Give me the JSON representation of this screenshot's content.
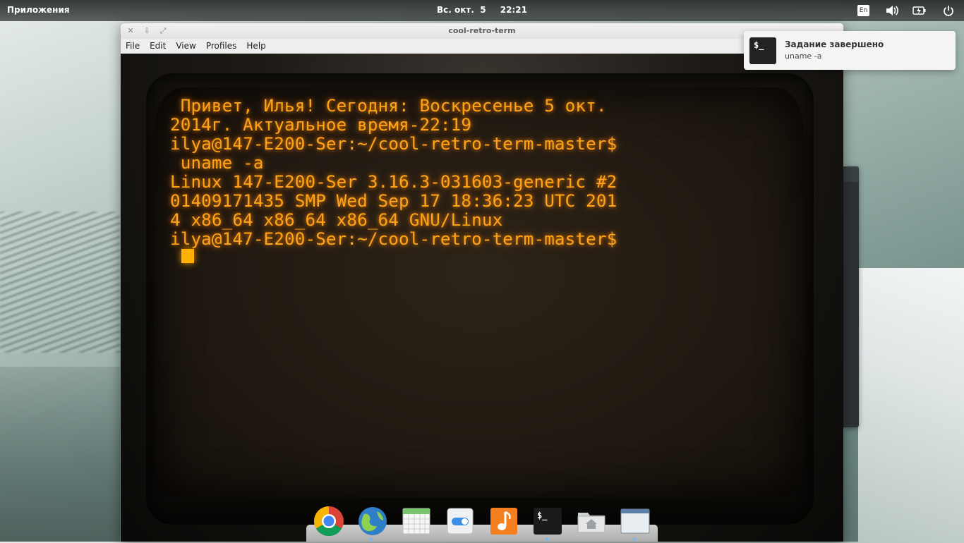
{
  "top_panel": {
    "apps_menu": "Приложения",
    "date": "Вс. окт.  5",
    "time": "22:21",
    "keyboard_layout": "En",
    "icons": [
      "keyboard-layout-icon",
      "volume-icon",
      "battery-icon",
      "power-icon"
    ]
  },
  "window": {
    "title": "cool-retro-term",
    "menu": [
      "File",
      "Edit",
      "View",
      "Profiles",
      "Help"
    ],
    "controls": [
      "close-icon",
      "minimize-icon",
      "maximize-icon"
    ]
  },
  "terminal": {
    "text": " Привет, Илья! Сегодня: Воскресенье 5 окт.\n2014г. Актуальное время-22:19\nilya@147-E200-Ser:~/cool-retro-term-master$\n uname -a\nLinux 147-E200-Ser 3.16.3-031603-generic #2\n01409171435 SMP Wed Sep 17 18:36:23 UTC 201\n4 x86_64 x86_64 x86_64 GNU/Linux\nilya@147-E200-Ser:~/cool-retro-term-master$",
    "text_color": "#ffa319"
  },
  "notification": {
    "icon_text": "$_",
    "title": "Задание завершено",
    "body": "uname -a"
  },
  "dock": {
    "items": [
      {
        "name": "chrome",
        "icon": "chrome-icon"
      },
      {
        "name": "midori-browser",
        "icon": "browser-globe-icon"
      },
      {
        "name": "calendar",
        "icon": "calendar-icon"
      },
      {
        "name": "settings",
        "icon": "settings-toggle-icon"
      },
      {
        "name": "music",
        "icon": "music-note-icon"
      },
      {
        "name": "terminal",
        "icon": "terminal-icon",
        "label": "$_"
      },
      {
        "name": "files",
        "icon": "home-folder-icon"
      },
      {
        "name": "window",
        "icon": "window-icon"
      }
    ]
  }
}
